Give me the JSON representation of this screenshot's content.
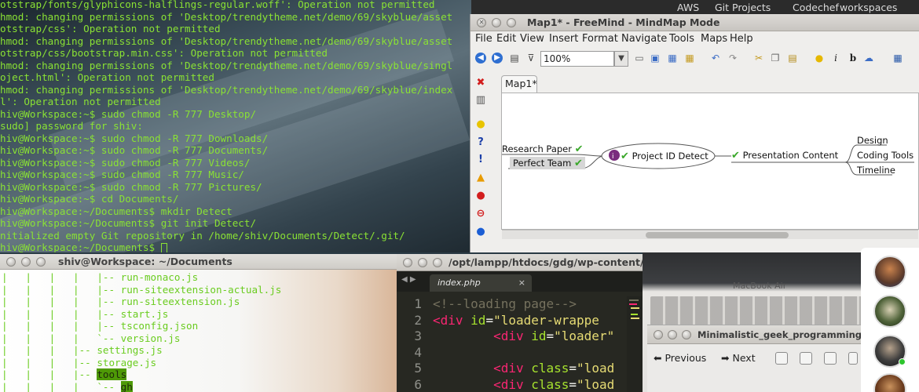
{
  "topbar": {
    "items": [
      "AWS",
      "Git Projects",
      "Codechef",
      "workspaces"
    ]
  },
  "terminal_top": {
    "lines": [
      "otstrap/fonts/glyphicons-halflings-regular.woff': Operation not permitted",
      "hmod: changing permissions of 'Desktop/trendytheme.net/demo/69/skyblue/asset",
      "otstrap/css': Operation not permitted",
      "hmod: changing permissions of 'Desktop/trendytheme.net/demo/69/skyblue/asset",
      "otstrap/css/bootstrap.min.css': Operation not permitted",
      "hmod: changing permissions of 'Desktop/trendytheme.net/demo/69/skyblue/singl",
      "oject.html': Operation not permitted",
      "hmod: changing permissions of 'Desktop/trendytheme.net/demo/69/skyblue/index",
      "l': Operation not permitted",
      "hiv@Workspace:~$ sudo chmod -R 777 Desktop/",
      "sudo] password for shiv:",
      "hiv@Workspace:~$ sudo chmod -R 777 Downloads/",
      "hiv@Workspace:~$ sudo chmod -R 777 Documents/",
      "hiv@Workspace:~$ sudo chmod -R 777 Videos/",
      "hiv@Workspace:~$ sudo chmod -R 777 Music/",
      "hiv@Workspace:~$ sudo chmod -R 777 Pictures/",
      "hiv@Workspace:~$ cd Documents/",
      "hiv@Workspace:~/Documents$ mkdir Detect",
      "hiv@Workspace:~/Documents$ git init Detect/",
      "nitialized empty Git repository in /home/shiv/Documents/Detect/.git/",
      "hiv@Workspace:~/Documents$ "
    ]
  },
  "freemind": {
    "title": "Map1* - FreeMind - MindMap Mode",
    "menu": [
      "File",
      "Edit",
      "View",
      "Insert",
      "Format",
      "Navigate",
      "Tools",
      "Maps",
      "Help"
    ],
    "zoom": "100%",
    "tab": "Map1*",
    "nodes": {
      "research": "Research Paper",
      "perfect": "Perfect Team",
      "center": "Project ID Detect",
      "presentation": "Presentation Content",
      "design": "Design",
      "coding": "Coding Tools",
      "timeline": "Timeline"
    },
    "colors": {
      "check": "#3aa82a",
      "edge": "#555555"
    }
  },
  "terminal_bottom": {
    "title": "shiv@Workspace: ~/Documents",
    "lines": [
      "|   |   |   |   |-- run-monaco.js",
      "|   |   |   |   |-- run-siteextension-actual.js",
      "|   |   |   |   |-- run-siteextension.js",
      "|   |   |   |   |-- start.js",
      "|   |   |   |   |-- tsconfig.json",
      "|   |   |   |   `-- version.js",
      "|   |   |   |-- settings.js",
      "|   |   |   |-- storage.js",
      "|   |   |   |-- tools",
      "|   |   |   |   `-- gh"
    ]
  },
  "sublime": {
    "title": "/opt/lampp/htdocs/gdg/wp-content/th",
    "tab": "index.php",
    "lines": [
      {
        "n": "1",
        "parts": [
          [
            "c-comment",
            "<!--loading page-->"
          ]
        ]
      },
      {
        "n": "2",
        "parts": [
          [
            "c-tag",
            "<div "
          ],
          [
            "c-attr",
            "id"
          ],
          [
            "c-plain",
            "="
          ],
          [
            "c-str",
            "\"loader-wrappe"
          ]
        ]
      },
      {
        "n": "3",
        "parts": [
          [
            "c-plain",
            "        "
          ],
          [
            "c-tag",
            "<div "
          ],
          [
            "c-attr",
            "id"
          ],
          [
            "c-plain",
            "="
          ],
          [
            "c-str",
            "\"loader\""
          ]
        ]
      },
      {
        "n": "4",
        "parts": [
          [
            "c-plain",
            ""
          ]
        ]
      },
      {
        "n": "5",
        "parts": [
          [
            "c-plain",
            "        "
          ],
          [
            "c-tag",
            "<div "
          ],
          [
            "c-attr",
            "class"
          ],
          [
            "c-plain",
            "="
          ],
          [
            "c-str",
            "\"load"
          ]
        ]
      },
      {
        "n": "6",
        "parts": [
          [
            "c-plain",
            "        "
          ],
          [
            "c-tag",
            "<div "
          ],
          [
            "c-attr",
            "class"
          ],
          [
            "c-plain",
            "="
          ],
          [
            "c-str",
            "\"load"
          ]
        ]
      }
    ]
  },
  "photo": {
    "label": "MacBook Air"
  },
  "viewer": {
    "title": "Minimalistic_geek_programming_",
    "previous": "Previous",
    "next": "Next"
  }
}
